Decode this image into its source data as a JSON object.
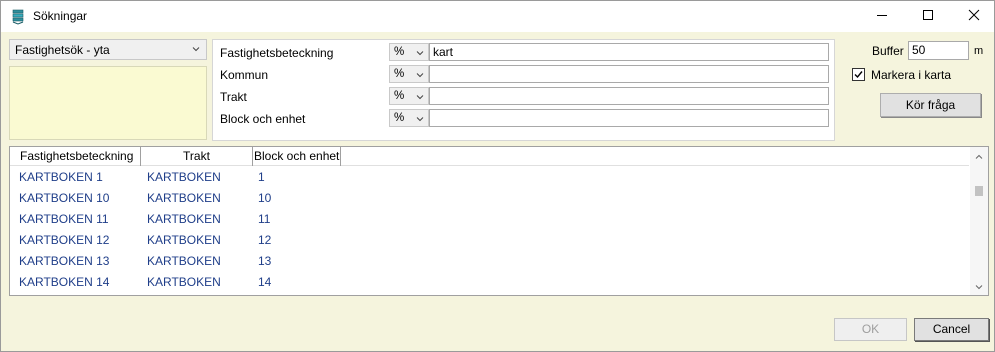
{
  "window": {
    "title": "Sökningar",
    "icon": "layers-icon",
    "controls": {
      "minimize": "minimize-icon",
      "maximize": "maximize-icon",
      "close": "close-icon"
    }
  },
  "search_type": {
    "selected": "Fastighetsök - yta"
  },
  "form": {
    "rows": [
      {
        "label": "Fastighetsbeteckning",
        "operator": "%",
        "value": "kart"
      },
      {
        "label": "Kommun",
        "operator": "%",
        "value": ""
      },
      {
        "label": "Trakt",
        "operator": "%",
        "value": ""
      },
      {
        "label": "Block och enhet",
        "operator": "%",
        "value": ""
      }
    ]
  },
  "options": {
    "buffer_label": "Buffer",
    "buffer_value": "50",
    "buffer_unit": "m",
    "mark_in_map_label": "Markera i karta",
    "mark_in_map_checked": true,
    "run_query_label": "Kör fråga"
  },
  "results": {
    "columns": [
      "Fastighetsbeteckning",
      "Trakt",
      "Block och enhet"
    ],
    "rows": [
      [
        "KARTBOKEN 1",
        "KARTBOKEN",
        "1"
      ],
      [
        "KARTBOKEN 10",
        "KARTBOKEN",
        "10"
      ],
      [
        "KARTBOKEN 11",
        "KARTBOKEN",
        "11"
      ],
      [
        "KARTBOKEN 12",
        "KARTBOKEN",
        "12"
      ],
      [
        "KARTBOKEN 13",
        "KARTBOKEN",
        "13"
      ],
      [
        "KARTBOKEN 14",
        "KARTBOKEN",
        "14"
      ]
    ]
  },
  "footer": {
    "ok_label": "OK",
    "cancel_label": "Cancel"
  },
  "colors": {
    "background": "#f5f4dd",
    "left_area": "#fafad2",
    "result_text": "#1f3e89"
  }
}
